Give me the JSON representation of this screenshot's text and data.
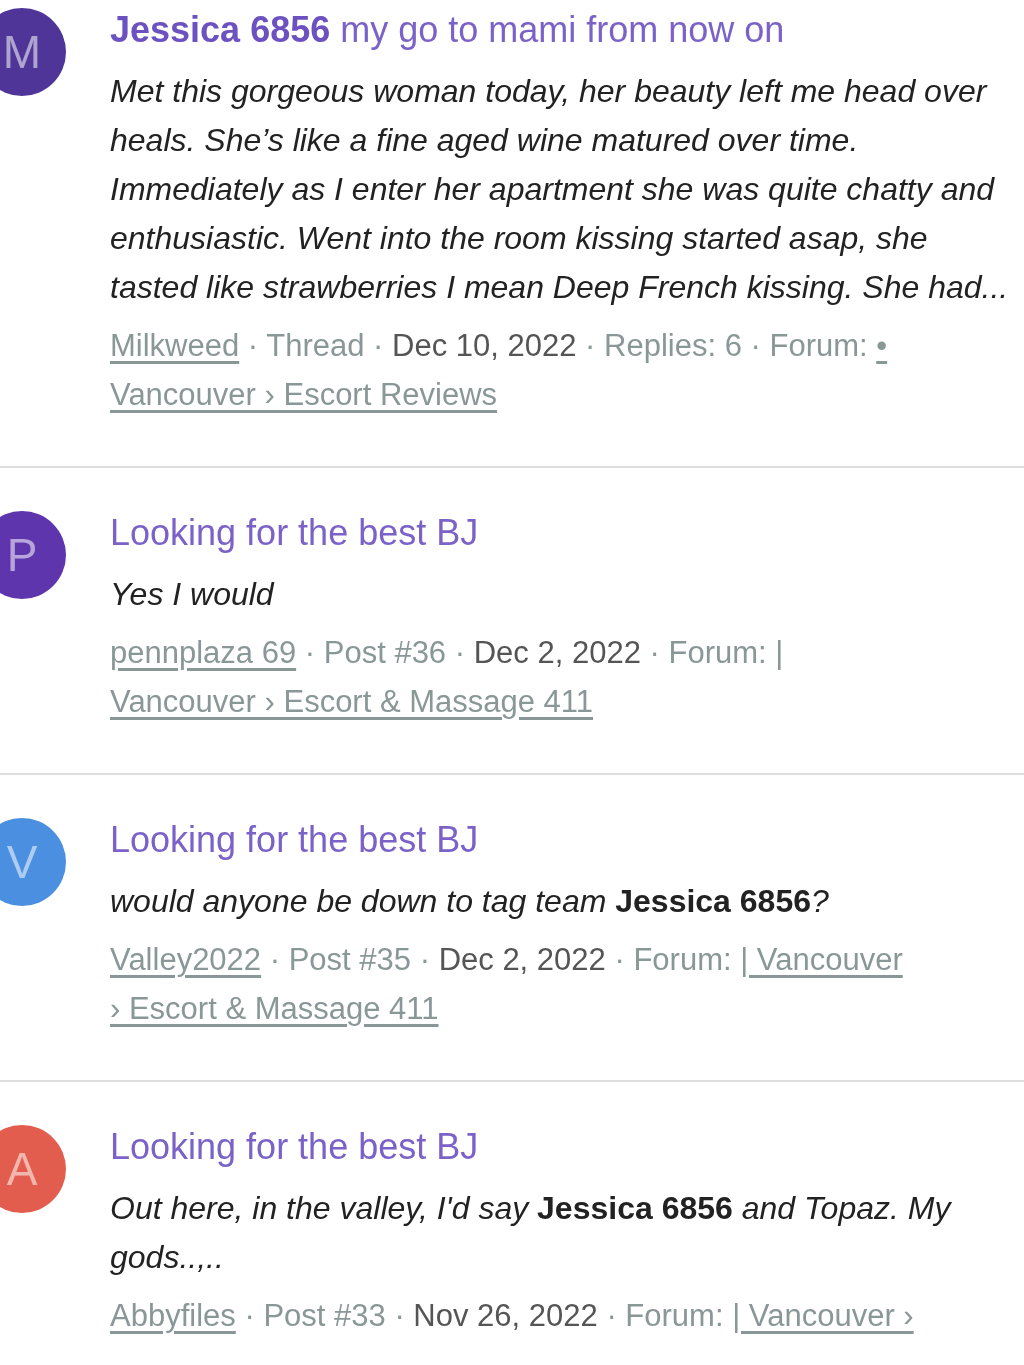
{
  "results": [
    {
      "avatar": {
        "letter": "M",
        "color": "#4e3597"
      },
      "title": "**Jessica 6856** my go to mami from now on",
      "body": "Met this gorgeous woman today, her beauty left me head over heals. She’s like a fine aged wine matured over time. Immediately as I enter her apartment she was quite chatty and enthusiastic. Went into the room kissing started asap, she tasted like strawberries I mean Deep French kissing. She had...",
      "meta": [
        {
          "kind": "user",
          "text": "Milkweed"
        },
        {
          "kind": "sep",
          "text": "·"
        },
        {
          "kind": "plain",
          "text": "Thread"
        },
        {
          "kind": "sep",
          "text": "·"
        },
        {
          "kind": "date",
          "text": "Dec 10, 2022"
        },
        {
          "kind": "sep",
          "text": "·"
        },
        {
          "kind": "plain",
          "text": "Replies: 6"
        },
        {
          "kind": "sep",
          "text": "·"
        },
        {
          "kind": "plain",
          "text": "Forum:"
        },
        {
          "kind": "forum",
          "text": "•"
        },
        {
          "kind": "forum",
          "text": "Vancouver › Escort Reviews"
        }
      ]
    },
    {
      "avatar": {
        "letter": "P",
        "color": "#5f35ad"
      },
      "title": "Looking for the best BJ",
      "body": "Yes I would",
      "meta": [
        {
          "kind": "user",
          "text": "pennplaza 69"
        },
        {
          "kind": "sep",
          "text": "·"
        },
        {
          "kind": "plain",
          "text": "Post #36"
        },
        {
          "kind": "sep",
          "text": "·"
        },
        {
          "kind": "date",
          "text": "Dec 2, 2022"
        },
        {
          "kind": "sep",
          "text": "·"
        },
        {
          "kind": "plain",
          "text": "Forum:"
        },
        {
          "kind": "forum",
          "text": "|"
        },
        {
          "kind": "forum",
          "text": "Vancouver › Escort & Massage 411"
        }
      ]
    },
    {
      "avatar": {
        "letter": "V",
        "color": "#4a8fe0"
      },
      "title": "Looking for the best BJ",
      "body": "would anyone be down to tag team **Jessica 6856**?",
      "meta": [
        {
          "kind": "user",
          "text": "Valley2022"
        },
        {
          "kind": "sep",
          "text": "·"
        },
        {
          "kind": "plain",
          "text": "Post #35"
        },
        {
          "kind": "sep",
          "text": "·"
        },
        {
          "kind": "date",
          "text": "Dec 2, 2022"
        },
        {
          "kind": "sep",
          "text": "·"
        },
        {
          "kind": "plain",
          "text": "Forum:"
        },
        {
          "kind": "forum",
          "text": "| Vancouver"
        },
        {
          "kind": "forum",
          "text": "› Escort & Massage 411"
        }
      ]
    },
    {
      "avatar": {
        "letter": "A",
        "color": "#e35d4f"
      },
      "title": "Looking for the best BJ",
      "body": "Out here, in the valley, I'd say **Jessica 6856** and Topaz. My gods..,..",
      "meta": [
        {
          "kind": "user",
          "text": "Abbyfiles"
        },
        {
          "kind": "sep",
          "text": "·"
        },
        {
          "kind": "plain",
          "text": "Post #33"
        },
        {
          "kind": "sep",
          "text": "·"
        },
        {
          "kind": "date",
          "text": "Nov 26, 2022"
        },
        {
          "kind": "sep",
          "text": "·"
        },
        {
          "kind": "plain",
          "text": "Forum:"
        },
        {
          "kind": "forum",
          "text": "| Vancouver ›"
        }
      ]
    }
  ]
}
